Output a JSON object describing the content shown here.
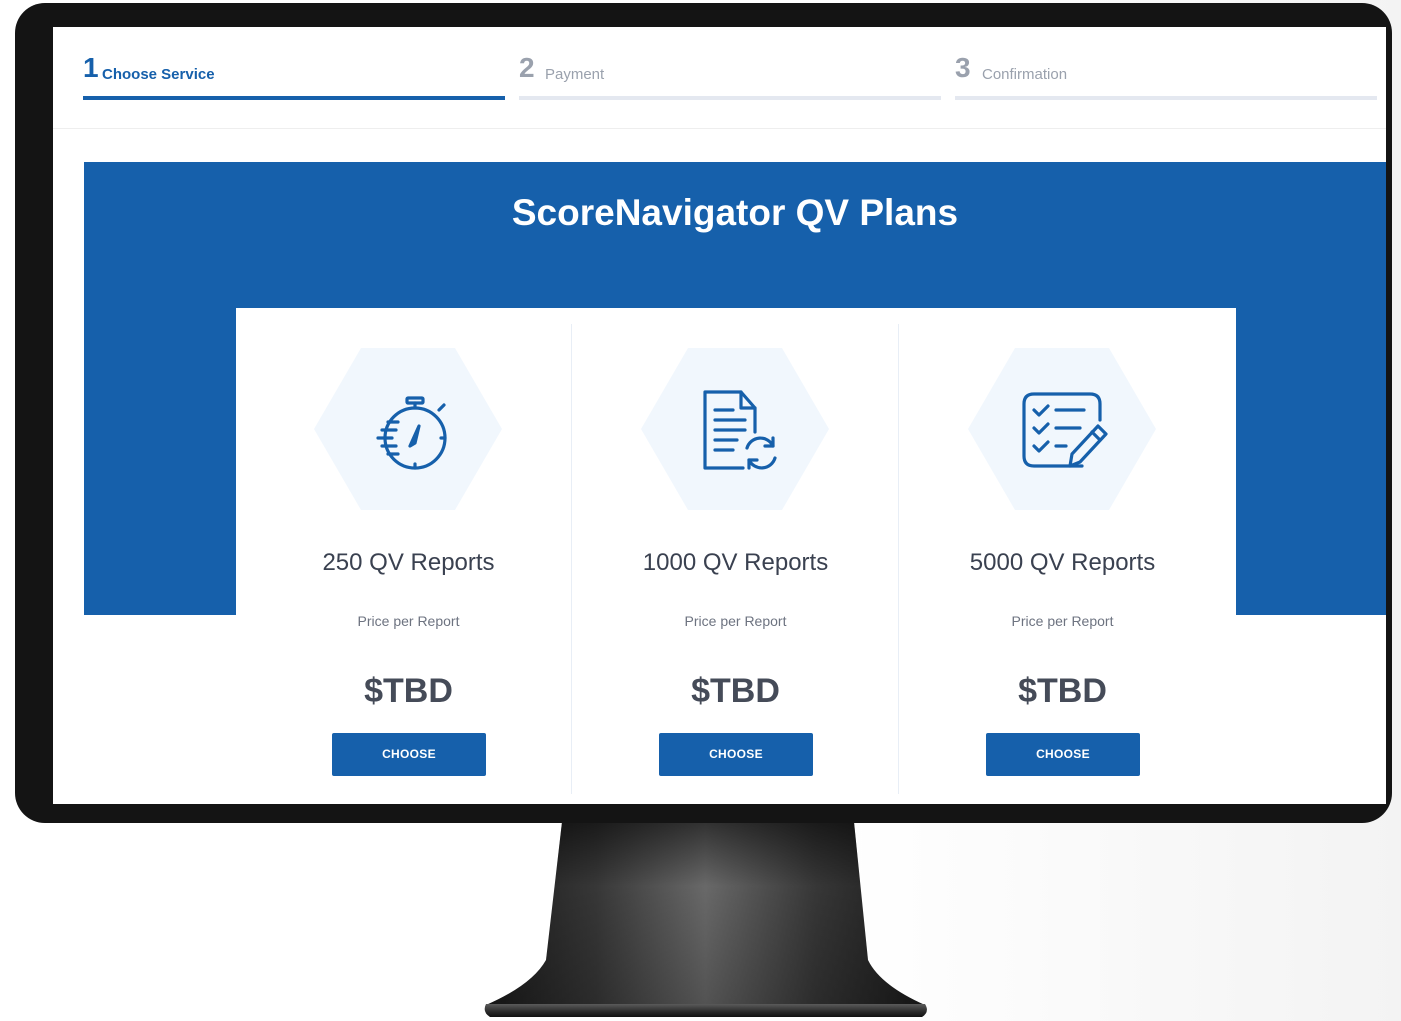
{
  "stepper": {
    "steps": [
      {
        "number": "1",
        "label": "Choose Service"
      },
      {
        "number": "2",
        "label": "Payment"
      },
      {
        "number": "3",
        "label": "Confirmation"
      }
    ],
    "active_index": 0,
    "active_color": "#1660ab",
    "inactive_color": "#9aa1ad"
  },
  "header": {
    "title": "ScoreNavigator QV Plans",
    "background_color": "#1660ab"
  },
  "plans": [
    {
      "icon": "stopwatch-icon",
      "title": "250 QV Reports",
      "subtitle": "Price per Report",
      "price": "$TBD",
      "button_label": "CHOOSE"
    },
    {
      "icon": "document-refresh-icon",
      "title": "1000 QV Reports",
      "subtitle": "Price per Report",
      "price": "$TBD",
      "button_label": "CHOOSE"
    },
    {
      "icon": "checklist-edit-icon",
      "title": "5000 QV Reports",
      "subtitle": "Price per Report",
      "price": "$TBD",
      "button_label": "CHOOSE"
    }
  ],
  "colors": {
    "brand_blue": "#1660ab",
    "icon_background": "#f1f7fd",
    "monitor_bezel": "#141414"
  }
}
